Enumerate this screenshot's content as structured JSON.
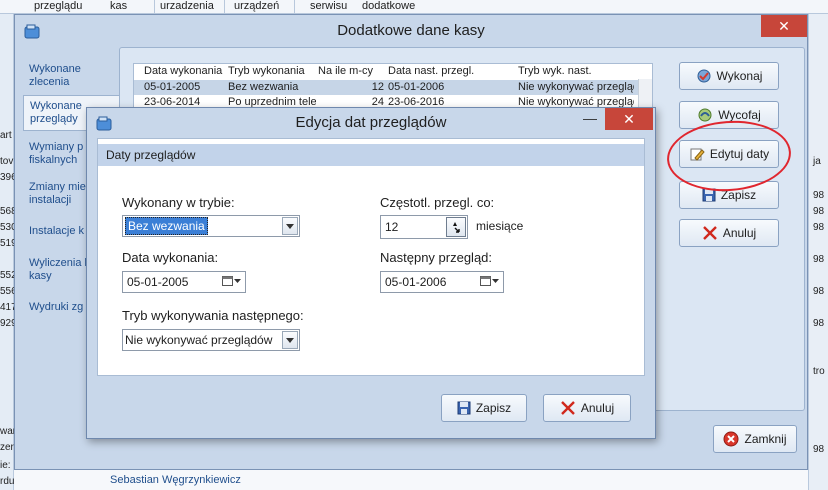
{
  "background": {
    "menubar": [
      "przeglądu",
      "kas",
      "urzadzenia",
      "urządzeń",
      "serwisu",
      "dodatkowe"
    ],
    "left_strip": [
      "art",
      "tov",
      "396",
      "568",
      "530",
      "519",
      "552",
      "556",
      "417",
      "929",
      "war",
      "zer",
      "ie:",
      "rdu:"
    ],
    "right_strip": [
      "ja",
      "98",
      "98",
      "98",
      "98",
      "98",
      "98",
      "tro",
      "98"
    ],
    "bottom_name": "Sebastian Węgrzynkiewicz"
  },
  "main_window": {
    "title": "Dodatkowe dane kasy",
    "close_glyph": "✕",
    "nav": [
      {
        "label": "Wykonane zlecenia"
      },
      {
        "label": "Wykonane przeglądy"
      },
      {
        "label": "Wymiany p fiskalnych"
      },
      {
        "label": "Zmiany mie instalacji"
      },
      {
        "label": "Instalacje k"
      },
      {
        "label": "Wyliczenia k kasy"
      },
      {
        "label": "Wydruki zg"
      }
    ],
    "grid": {
      "columns": [
        "Data wykonania",
        "Tryb wykonania",
        "Na ile m-cy",
        "Data nast. przegl.",
        "Tryb wyk. nast."
      ],
      "rows": [
        [
          "05-01-2005",
          "Bez wezwania",
          "12",
          "05-01-2006",
          "Nie wykonywać przeglądó"
        ],
        [
          "23-06-2014",
          "Po uprzednim tele",
          "24",
          "23-06-2016",
          "Nie wykonywać przeglądó"
        ]
      ]
    },
    "buttons": {
      "wykonaj": "Wykonaj",
      "wycofaj": "Wycofaj",
      "edytuj": "Edytuj daty",
      "zapisz": "Zapisz",
      "anuluj": "Anuluj",
      "zamknij": "Zamknij"
    }
  },
  "dialog": {
    "title": "Edycja dat przeglądów",
    "minimize_glyph": "—",
    "close_glyph": "✕",
    "section": "Daty przeglądów",
    "wykonany_label": "Wykonany w trybie:",
    "wykonany_value": "Bez wezwania",
    "data_wyk_label": "Data wykonania:",
    "data_wyk_value": "05-01-2005",
    "tryb_nast_label": "Tryb wykonywania następnego:",
    "tryb_nast_value": "Nie wykonywać przeglądów",
    "czestotl_label": "Częstotl. przegl. co:",
    "czestotl_value": "12",
    "czestotl_unit": "miesiące",
    "nastepny_label": "Następny przegląd:",
    "nastepny_value": "05-01-2006",
    "zapisz": "Zapisz",
    "anuluj": "Anuluj"
  },
  "colors": {
    "accent": "#c2d3ea",
    "close_red": "#c7463a",
    "annotation": "#e0262e",
    "link": "#1f4e8c"
  }
}
